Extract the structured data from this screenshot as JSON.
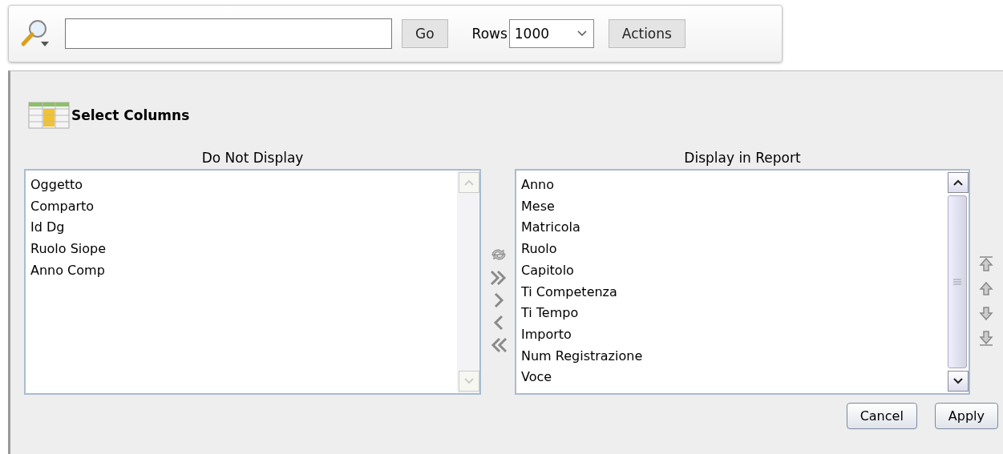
{
  "toolbar": {
    "go_button": "Go",
    "rows_label": "Rows",
    "rows_select": "1000",
    "actions_button": "Actions"
  },
  "panel": {
    "title": "Select Columns",
    "lists": [
      {
        "heading": "Do Not Display",
        "scrollable": false,
        "items": [
          "Oggetto",
          "Comparto",
          "Id Dg",
          "Ruolo Siope",
          "Anno Comp"
        ]
      },
      {
        "heading": "Display in Report",
        "scrollable": true,
        "items": [
          "Anno",
          "Mese",
          "Matricola",
          "Ruolo",
          "Capitolo",
          "Ti Competenza",
          "Ti Tempo",
          "Importo",
          "Num Registrazione",
          "Voce"
        ]
      }
    ],
    "buttons": [
      "Cancel",
      "Apply"
    ]
  }
}
